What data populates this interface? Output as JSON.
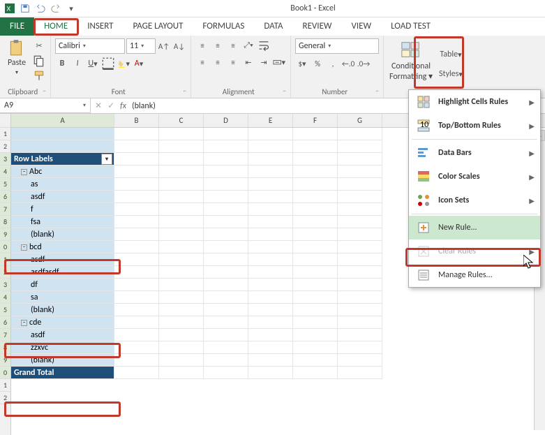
{
  "title": "Book1 - Excel",
  "tabs": {
    "file": "FILE",
    "home": "HOME",
    "insert": "INSERT",
    "pagelayout": "PAGE LAYOUT",
    "formulas": "FORMULAS",
    "data": "DATA",
    "review": "REVIEW",
    "view": "VIEW",
    "loadtest": "LOAD TEST"
  },
  "clipboard": {
    "paste": "Paste",
    "label": "Clipboard"
  },
  "font": {
    "name": "Calibri",
    "size": "11",
    "label": "Font"
  },
  "alignment": {
    "label": "Alignment"
  },
  "number": {
    "format": "General",
    "label": "Number"
  },
  "styles": {
    "cf": "Conditional",
    "cf2": "Formatting",
    "table": "Table",
    "styles": "Styles"
  },
  "name_box": "A9",
  "formula": "(blank)",
  "cols": [
    "A",
    "B",
    "C",
    "D",
    "E",
    "F",
    "G"
  ],
  "rownums": [
    "1",
    "2",
    "3",
    "4",
    "5",
    "6",
    "7",
    "8",
    "9",
    "0",
    "1",
    "2",
    "3",
    "4",
    "5",
    "6",
    "7",
    "8",
    "9",
    "0"
  ],
  "pivot": {
    "header": "Row Labels",
    "grand": "Grand Total",
    "data": [
      {
        "t": "Abc",
        "lvl": 1,
        "exp": true
      },
      {
        "t": "as",
        "lvl": 2
      },
      {
        "t": "asdf",
        "lvl": 2
      },
      {
        "t": "f",
        "lvl": 2
      },
      {
        "t": "fsa",
        "lvl": 2
      },
      {
        "t": "(blank)",
        "lvl": 2
      },
      {
        "t": "bcd",
        "lvl": 1,
        "exp": true
      },
      {
        "t": "asdf",
        "lvl": 2
      },
      {
        "t": "asdfasdf",
        "lvl": 2
      },
      {
        "t": "df",
        "lvl": 2
      },
      {
        "t": "sa",
        "lvl": 2
      },
      {
        "t": "(blank)",
        "lvl": 2
      },
      {
        "t": "cde",
        "lvl": 1,
        "exp": true
      },
      {
        "t": "asdf",
        "lvl": 2
      },
      {
        "t": "zzxvc",
        "lvl": 2
      },
      {
        "t": "(blank)",
        "lvl": 2
      }
    ]
  },
  "cf_menu": {
    "hcr": "Highlight Cells Rules",
    "tbr": "Top/Bottom Rules",
    "db": "Data Bars",
    "cs": "Color Scales",
    "is": "Icon Sets",
    "new": "New Rule...",
    "clear": "Clear Rules",
    "manage": "Manage Rules..."
  }
}
